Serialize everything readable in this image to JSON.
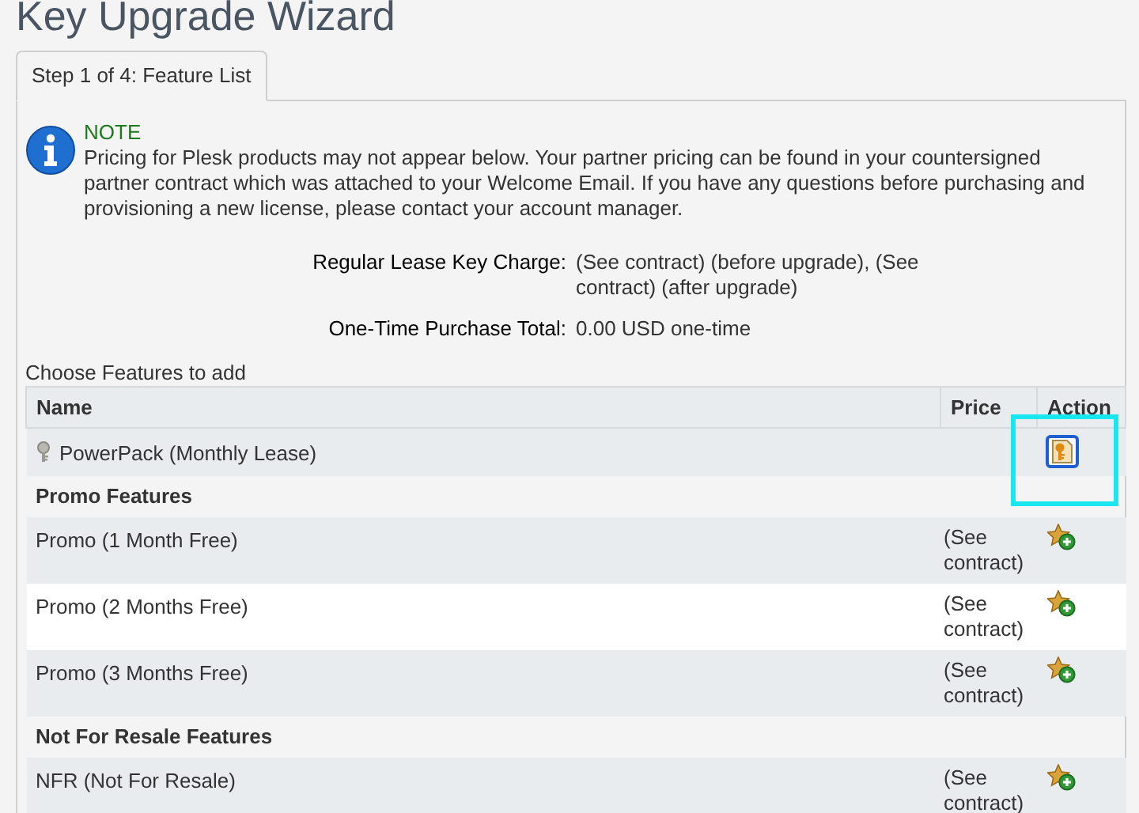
{
  "title": "Key Upgrade Wizard",
  "tabs": [
    {
      "label": "Step 1 of 4: Feature List",
      "selected": true
    }
  ],
  "note": {
    "heading": "NOTE",
    "text": "Pricing for Plesk products may not appear below. Your partner pricing can be found in your countersigned partner contract which was attached to your Welcome Email. If you have any questions before purchasing and provisioning a new license, please contact your account manager."
  },
  "summary": [
    {
      "label": "Regular Lease Key Charge:",
      "value": "(See contract) (before upgrade), (See contract) (after upgrade)"
    },
    {
      "label": "One-Time Purchase Total:",
      "value": "0.00 USD one-time"
    }
  ],
  "table": {
    "caption": "Choose Features to add",
    "columns": [
      "Name",
      "Price",
      "Action"
    ],
    "rows": [
      {
        "kind": "license",
        "name": "PowerPack (Monthly Lease)",
        "highlighted": true
      },
      {
        "kind": "section",
        "name": "Promo Features"
      },
      {
        "kind": "feature",
        "name": "Promo (1 Month Free)",
        "price": "(See contract)",
        "highlighted": false
      },
      {
        "kind": "feature",
        "name": "Promo (2 Months Free)",
        "price": "(See contract)",
        "highlighted": false
      },
      {
        "kind": "feature",
        "name": "Promo (3 Months Free)",
        "price": "(See contract)",
        "highlighted": false
      },
      {
        "kind": "section",
        "name": "Not For Resale Features"
      },
      {
        "kind": "feature",
        "name": "NFR (Not For Resale)",
        "price": "(See contract)",
        "highlighted": false
      }
    ]
  }
}
